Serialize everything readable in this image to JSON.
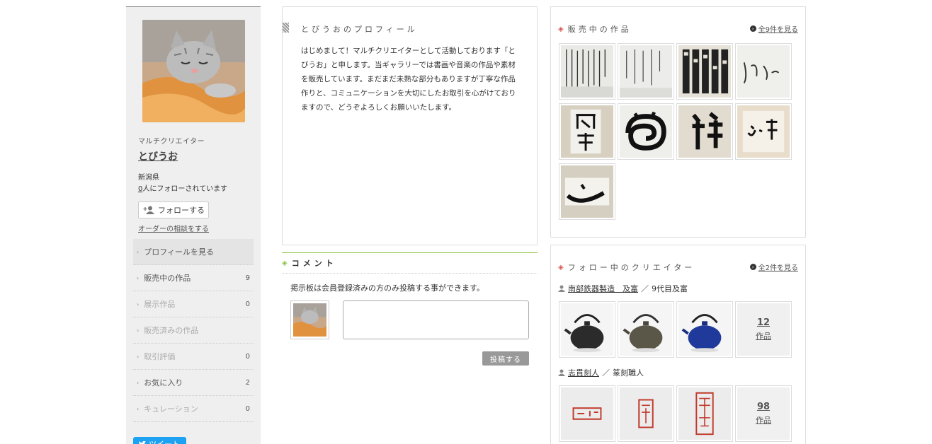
{
  "sidebar": {
    "role": "マルチクリエイター",
    "name": "とびうお",
    "prefecture": "新潟県",
    "followers_count": "0",
    "followers_suffix": "人にフォローされています",
    "follow_button": "フォローする",
    "order_link": "オーダーの相談をする",
    "menu": [
      {
        "label": "プロフィールを見る",
        "count": ""
      },
      {
        "label": "販売中の作品",
        "count": "9"
      },
      {
        "label": "展示作品",
        "count": "0"
      },
      {
        "label": "販売済みの作品",
        "count": ""
      },
      {
        "label": "取引評価",
        "count": "0"
      },
      {
        "label": "お気に入り",
        "count": "2"
      },
      {
        "label": "キュレーション",
        "count": "0"
      }
    ],
    "tweet": "ツイート"
  },
  "profile": {
    "title": "とびうおのプロフィール",
    "text": "はじめまして！マルチクリエイターとして活動しております「とびうお」と申します。当ギャラリーでは書画や音楽の作品や素材を販売しています。まだまだ未熟な部分もありますが丁寧な作品作りと、コミュニケーションを大切にしたお取引を心がけておりますので、どうぞよろしくお願いいたします。"
  },
  "comment": {
    "title": "コメント",
    "note": "掲示板は会員登録済みの方のみ投稿する事ができます。",
    "post_button": "投稿する"
  },
  "works": {
    "title": "販売中の作品",
    "see_all": "全9件を見る",
    "items": [
      "calligraphy-1",
      "calligraphy-2",
      "calligraphy-3",
      "calligraphy-4",
      "calligraphy-5",
      "calligraphy-6",
      "calligraphy-7",
      "calligraphy-8",
      "calligraphy-9"
    ]
  },
  "following": {
    "title": "フォロー中のクリエイター",
    "see_all": "全2件を見る",
    "creators": [
      {
        "name": "南部鉄器製造　及富",
        "sep": "／",
        "role": "9代目及富",
        "count": "12",
        "count_label": "作品"
      },
      {
        "name": "志貫刻人",
        "sep": "／",
        "role": "篆刻職人",
        "count": "98",
        "count_label": "作品"
      }
    ]
  },
  "colors": {
    "sidebar_bg": "#efefef",
    "accent_green": "#8bc34a",
    "accent_red": "#d9534f",
    "tweet_blue": "#1da1f2"
  }
}
